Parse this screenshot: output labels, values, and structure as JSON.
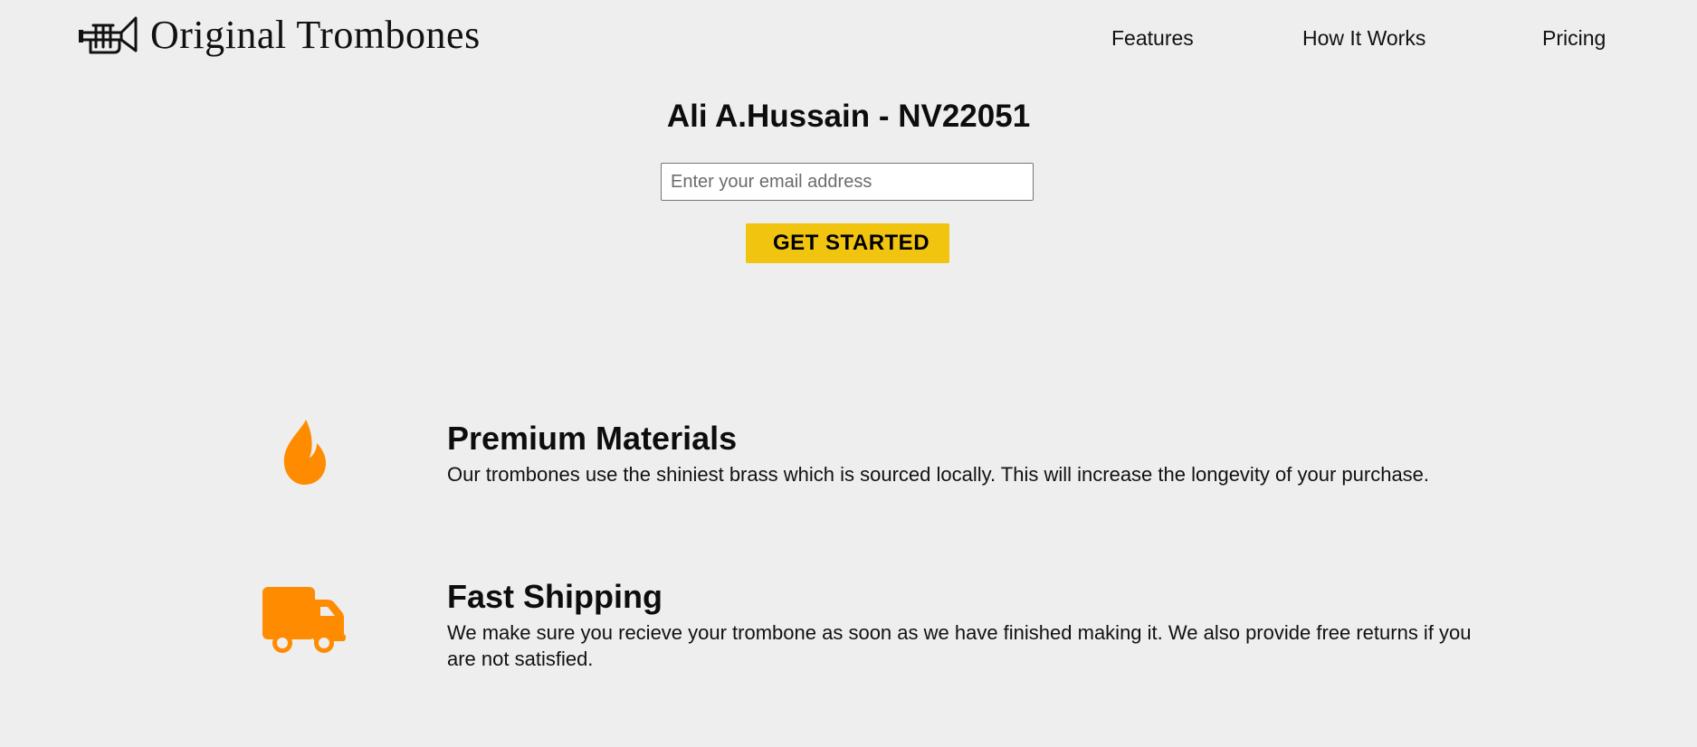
{
  "header": {
    "brand": "Original Trombones",
    "logo_icon": "trumpet-icon",
    "nav": {
      "features": "Features",
      "how_it_works": "How It Works",
      "pricing": "Pricing"
    }
  },
  "hero": {
    "title": "Ali A.Hussain - NV22051",
    "email_placeholder": "Enter your email address",
    "email_value": "",
    "cta_label": "GET STARTED"
  },
  "features": [
    {
      "icon": "fire-icon",
      "title": "Premium Materials",
      "text": "Our trombones use the shiniest brass which is sourced locally. This will increase the longevity of your purchase."
    },
    {
      "icon": "truck-icon",
      "title": "Fast Shipping",
      "text": "We make sure you recieve your trombone as soon as we have finished making it. We also provide free returns if you are not satisfied."
    }
  ],
  "colors": {
    "background": "#eeeeee",
    "accent_button": "#f1c40f",
    "icon_orange": "#ff8c00",
    "text": "#111111"
  }
}
